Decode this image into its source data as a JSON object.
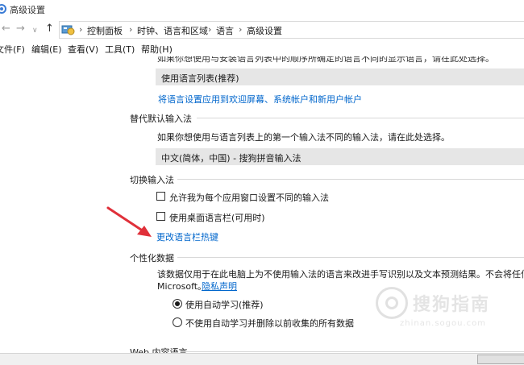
{
  "window": {
    "title": "高级设置"
  },
  "nav": {
    "back": "←",
    "forward": "→",
    "dropdown": "∨",
    "up": "↑",
    "breadcrumbs": [
      "控制面板",
      "时钟、语言和区域",
      "语言",
      "高级设置"
    ],
    "separator": "›"
  },
  "menu": {
    "items": [
      "文件(F)",
      "编辑(E)",
      "查看(V)",
      "工具(T)",
      "帮助(H)"
    ]
  },
  "display_language": {
    "clipped_text": "如果你想使用与安装语言列表中的顺序所确定的语言不同的显示语言，请在此处选择。",
    "selected": "使用语言列表(推荐)",
    "apply_link": "将语言设置应用到欢迎屏幕、系统帐户和新用户帐户"
  },
  "override_input": {
    "heading": "替代默认输入法",
    "description": "如果你想使用与语言列表上的第一个输入法不同的输入法，请在此处选择。",
    "selected": "中文(简体，中国) - 搜狗拼音输入法"
  },
  "switch_input": {
    "heading": "切换输入法",
    "option1": "允许我为每个应用窗口设置不同的输入法",
    "option2": "使用桌面语言栏(可用时)",
    "hotkeys_link": "更改语言栏热键"
  },
  "personalization": {
    "heading": "个性化数据",
    "description": "该数据仅用于在此电脑上为不使用输入法的语言来改进手写识别以及文本预测结果。不会将任何信息发送到",
    "line2": "Microsoft。",
    "privacy_link": "隐私声明",
    "radio1": "使用自动学习(推荐)",
    "radio2": "不使用自动学习并删除以前收集的所有数据"
  },
  "web_content": {
    "heading": "Web 内容语言"
  },
  "watermark": {
    "cn": "搜狗指南",
    "en": "zhinan.sogou.com"
  },
  "colors": {
    "link": "#0066cc",
    "arrow": "#e0303a",
    "dropdown_bg": "#e6e6e6"
  }
}
